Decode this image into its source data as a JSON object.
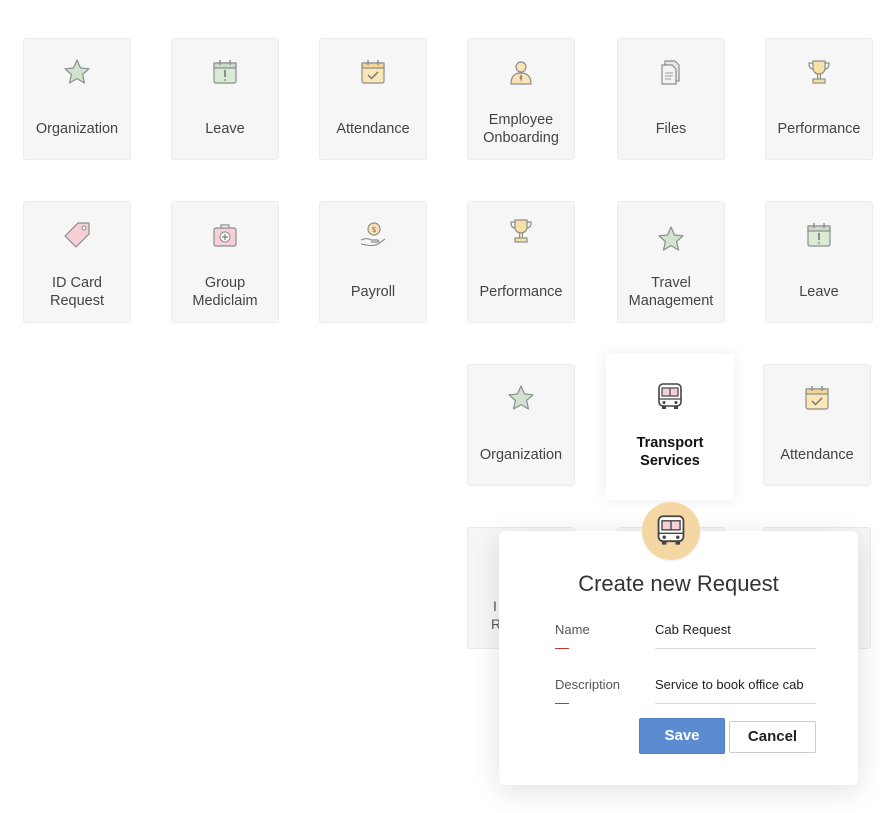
{
  "tiles": {
    "organization_1": "Organization",
    "leave_1": "Leave",
    "attendance_1": "Attendance",
    "onboarding": "Employee Onboarding",
    "files": "Files",
    "performance_1": "Performance",
    "id_card": "ID Card Request",
    "mediclaim": "Group Mediclaim",
    "payroll": "Payroll",
    "performance_2": "Performance",
    "travel": "Travel Management",
    "leave_2": "Leave",
    "organization_2": "Organization",
    "transport": "Transport Services",
    "attendance_2": "Attendance"
  },
  "hidden_tile_fragment": [
    "I",
    "R"
  ],
  "modal": {
    "title": "Create new Request",
    "name_label": "Name",
    "name_value": "Cab Request",
    "description_label": "Description",
    "description_value": "Service to book office cab",
    "save_label": "Save",
    "cancel_label": "Cancel"
  },
  "colors": {
    "save_button": "#5b8bd0",
    "badge_background": "#f5d7a3",
    "field_marker": "#c0392b"
  },
  "icons": {
    "organization": "star-icon",
    "leave": "calendar-exclamation-icon",
    "attendance": "calendar-check-icon",
    "onboarding": "person-icon",
    "files": "files-icon",
    "performance": "trophy-icon",
    "id_card": "tag-icon",
    "mediclaim": "medical-kit-icon",
    "payroll": "hand-coin-icon",
    "travel": "star-icon",
    "transport": "bus-icon"
  }
}
